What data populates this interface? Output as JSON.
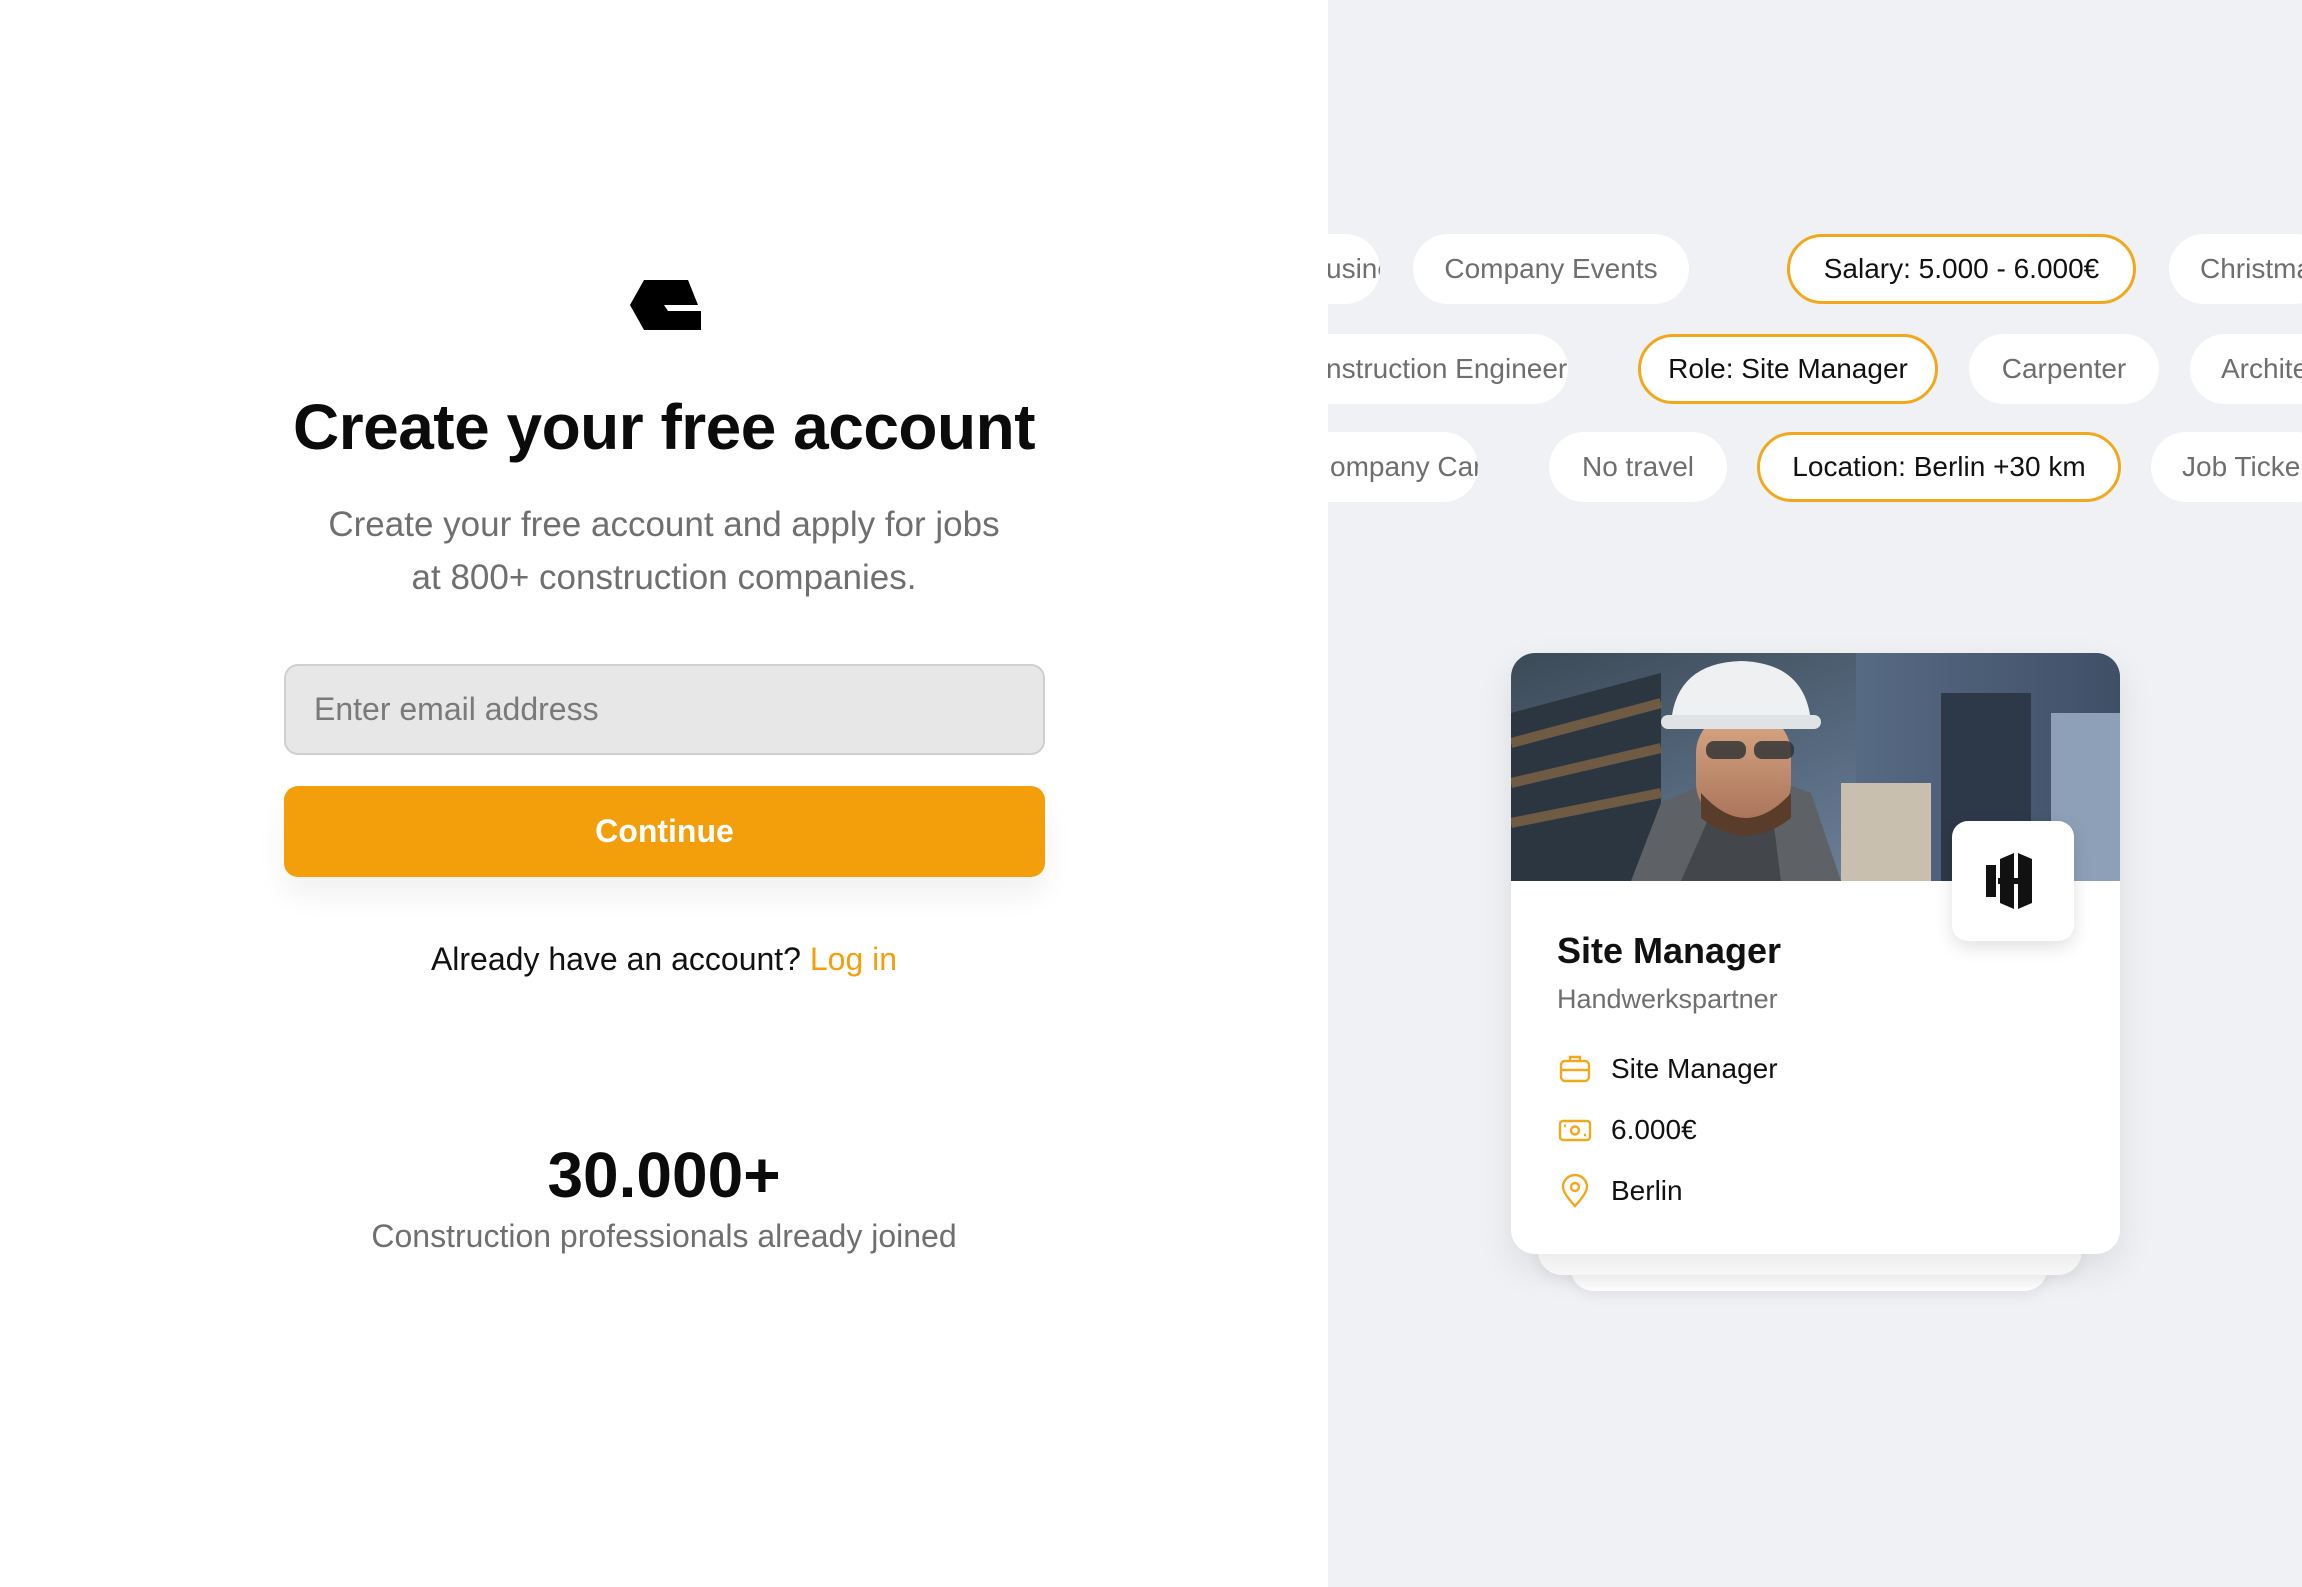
{
  "signup": {
    "title": "Create your free account",
    "subtitle_line1": "Create your free account and apply for jobs",
    "subtitle_line2": "at 800+ construction companies.",
    "email_placeholder": "Enter email address",
    "continue_label": "Continue",
    "login_prompt": "Already have an account?",
    "login_link": "Log in"
  },
  "stats": {
    "count": "30.000+",
    "label": "Construction professionals already joined"
  },
  "filter_chips": {
    "row1": [
      {
        "label": "usiness",
        "active": false
      },
      {
        "label": "Company Events",
        "active": false
      },
      {
        "label": "Salary: 5.000 - 6.000€",
        "active": true
      },
      {
        "label": "Christma",
        "active": false
      }
    ],
    "row2": [
      {
        "label": "nstruction Engineer",
        "active": false
      },
      {
        "label": "Role: Site Manager",
        "active": true
      },
      {
        "label": "Carpenter",
        "active": false
      },
      {
        "label": "Archite",
        "active": false
      }
    ],
    "row3": [
      {
        "label": "ompany Car",
        "active": false
      },
      {
        "label": "No travel",
        "active": false
      },
      {
        "label": "Location: Berlin +30 km",
        "active": true
      },
      {
        "label": "Job Ticke",
        "active": false
      }
    ]
  },
  "job_card": {
    "title": "Site Manager",
    "company": "Handwerkspartner",
    "role": "Site Manager",
    "salary": "6.000€",
    "location": "Berlin",
    "role_icon": "briefcase-icon",
    "salary_icon": "banknote-icon",
    "location_icon": "map-pin-icon"
  },
  "colors": {
    "accent": "#f39f0c",
    "right_panel_bg": "#f0f1f4",
    "text_dark": "#0b0b0b",
    "text_muted": "#6f6f6f"
  }
}
